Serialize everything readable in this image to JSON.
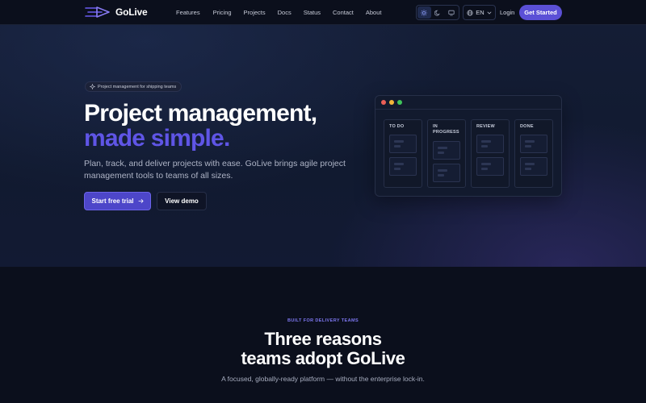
{
  "nav": {
    "brand": "GoLive",
    "links": [
      "Features",
      "Pricing",
      "Projects",
      "Docs",
      "Status",
      "Contact",
      "About"
    ],
    "language": "EN",
    "login": "Login",
    "cta": "Get Started"
  },
  "hero": {
    "tag": "Project management for shipping teams",
    "headline_line1": "Project management,",
    "headline_line2": "made simple.",
    "subtext": "Plan, track, and deliver projects with ease. GoLive brings agile project management tools to teams of all sizes.",
    "primary_button": "Start free trial",
    "secondary_button": "View demo"
  },
  "board": {
    "columns": [
      {
        "title": "TO DO"
      },
      {
        "title": "IN PROGRESS"
      },
      {
        "title": "REVIEW"
      },
      {
        "title": "DONE"
      }
    ]
  },
  "reasons": {
    "eyebrow": "BUILT FOR DELIVERY TEAMS",
    "title_line1": "Three reasons",
    "title_line2": "teams adopt GoLive",
    "subtitle": "A focused, globally-ready platform — without the enterprise lock-in."
  },
  "colors": {
    "accent": "#5f55e6",
    "cta": "#5b50d6",
    "background": "#0b0f1c"
  },
  "icons": {
    "logo": "speed-arrow-icon",
    "light_theme": "sun-icon",
    "dark_theme": "moon-icon",
    "system_theme": "monitor-icon",
    "language": "globe-icon",
    "tag": "sparkle-icon",
    "primary_button": "arrow-right-icon"
  }
}
